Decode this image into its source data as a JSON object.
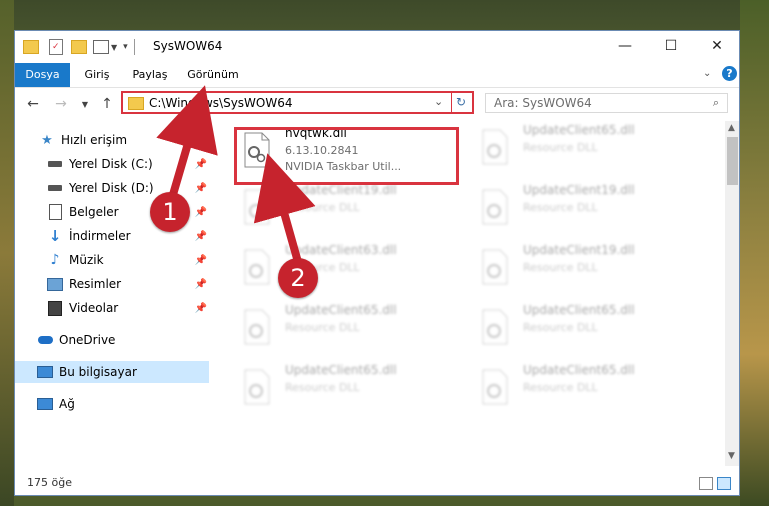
{
  "window": {
    "title": "SysWOW64",
    "controls": {
      "minimize": "—",
      "maximize": "☐",
      "close": "✕"
    }
  },
  "ribbon": {
    "tabs": [
      "Dosya",
      "Giriş",
      "Paylaş",
      "Görünüm"
    ],
    "active_tab_color": "#1979ca"
  },
  "navigation": {
    "address": "C:\\Windows\\SysWOW64",
    "search_placeholder": "Ara: SysWOW64"
  },
  "sidebar": {
    "items": [
      {
        "label": "Hızlı erişim",
        "icon": "star-icon"
      },
      {
        "label": "Yerel Disk (C:)",
        "icon": "drive-icon"
      },
      {
        "label": "Yerel Disk (D:)",
        "icon": "drive-icon"
      },
      {
        "label": "Belgeler",
        "icon": "documents-icon"
      },
      {
        "label": "İndirmeler",
        "icon": "download-icon"
      },
      {
        "label": "Müzik",
        "icon": "music-icon"
      },
      {
        "label": "Resimler",
        "icon": "pictures-icon"
      },
      {
        "label": "Videolar",
        "icon": "videos-icon"
      },
      {
        "label": "OneDrive",
        "icon": "cloud-icon"
      },
      {
        "label": "Bu bilgisayar",
        "icon": "computer-icon"
      },
      {
        "label": "Ağ",
        "icon": "network-icon"
      }
    ]
  },
  "files": {
    "highlighted": {
      "name": "nvqtwk.dll",
      "version": "6.13.10.2841",
      "description": "NVIDIA Taskbar Util..."
    },
    "others": [
      {
        "name": "UpdateClient65.dll",
        "description": "Resource DLL"
      },
      {
        "name": "UpdateClient19.dll",
        "description": "Resource DLL"
      },
      {
        "name": "UpdateClient19.dll",
        "description": "Resource DLL"
      },
      {
        "name": "UpdateClient63.dll",
        "description": "Resource DLL"
      },
      {
        "name": "UpdateClient19.dll",
        "description": "Resource DLL"
      },
      {
        "name": "UpdateClient65.dll",
        "description": "Resource DLL"
      },
      {
        "name": "UpdateClient65.dll",
        "description": "Resource DLL"
      },
      {
        "name": "UpdateClient65.dll",
        "description": "Resource DLL"
      },
      {
        "name": "UpdateClient65.dll",
        "description": "Resource DLL"
      }
    ]
  },
  "status": {
    "item_count": "175 öğe"
  },
  "annotations": {
    "markers": [
      "1",
      "2"
    ],
    "color": "#c6232d"
  }
}
